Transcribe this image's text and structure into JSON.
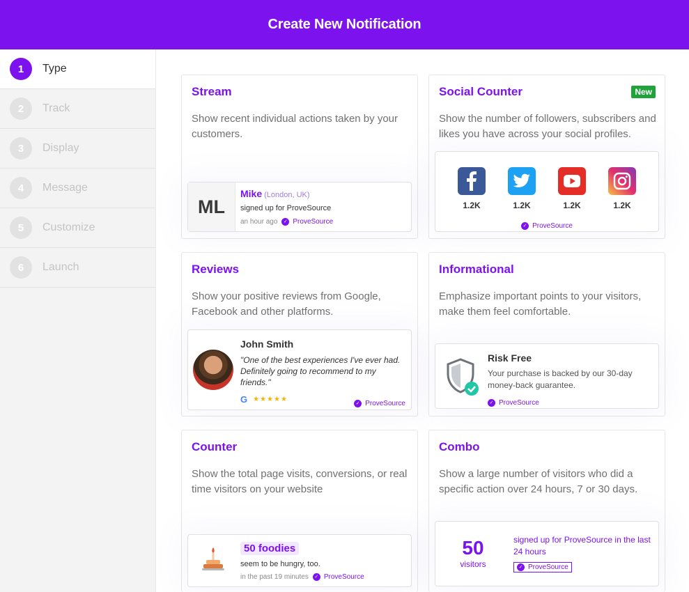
{
  "header": {
    "title": "Create New Notification"
  },
  "steps": [
    {
      "num": "1",
      "label": "Type"
    },
    {
      "num": "2",
      "label": "Track"
    },
    {
      "num": "3",
      "label": "Display"
    },
    {
      "num": "4",
      "label": "Message"
    },
    {
      "num": "5",
      "label": "Customize"
    },
    {
      "num": "6",
      "label": "Launch"
    }
  ],
  "cards": {
    "stream": {
      "title": "Stream",
      "desc": "Show recent individual actions taken by your customers.",
      "initials": "ML",
      "name": "Mike",
      "location": "(London, UK)",
      "action": "signed up for ProveSource",
      "time": "an hour ago",
      "brand": "ProveSource"
    },
    "social": {
      "title": "Social Counter",
      "badge": "New",
      "desc": "Show the number of followers, subscribers and likes you have across your social profiles.",
      "networks": [
        {
          "icon": "facebook-icon",
          "count": "1.2K",
          "color": "#3b5998"
        },
        {
          "icon": "twitter-icon",
          "count": "1.2K",
          "color": "#1da1f2"
        },
        {
          "icon": "youtube-icon",
          "count": "1.2K",
          "color": "#e52d27"
        },
        {
          "icon": "instagram-icon",
          "count": "1.2K",
          "color": "#c13584"
        }
      ],
      "brand": "ProveSource"
    },
    "reviews": {
      "title": "Reviews",
      "desc": "Show your positive reviews from Google, Facebook and other platforms.",
      "name": "John Smith",
      "quote": "\"One of the best experiences I've ever had. Definitely going to recommend to my friends.\"",
      "stars": "★★★★★",
      "brand": "ProveSource"
    },
    "informational": {
      "title": "Informational",
      "desc": "Emphasize important points to your visitors, make them feel comfortable.",
      "heading": "Risk Free",
      "text": "Your purchase is backed by our 30-day money-back guarantee.",
      "brand": "ProveSource"
    },
    "counter": {
      "title": "Counter",
      "desc": "Show the total page visits, conversions, or real time visitors on your website",
      "highlight": "50 foodies",
      "sub": "seem to be hungry, too.",
      "time": "in the past 19 minutes",
      "brand": "ProveSource"
    },
    "combo": {
      "title": "Combo",
      "desc": "Show a large number of visitors who did a specific action over 24 hours, 7 or 30 days.",
      "number": "50",
      "unit": "visitors",
      "text": "signed up for ProveSource in the last 24 hours",
      "brand": "ProveSource"
    }
  },
  "colors": {
    "accent": "#7c12ee",
    "new_badge": "#1fa33a"
  }
}
